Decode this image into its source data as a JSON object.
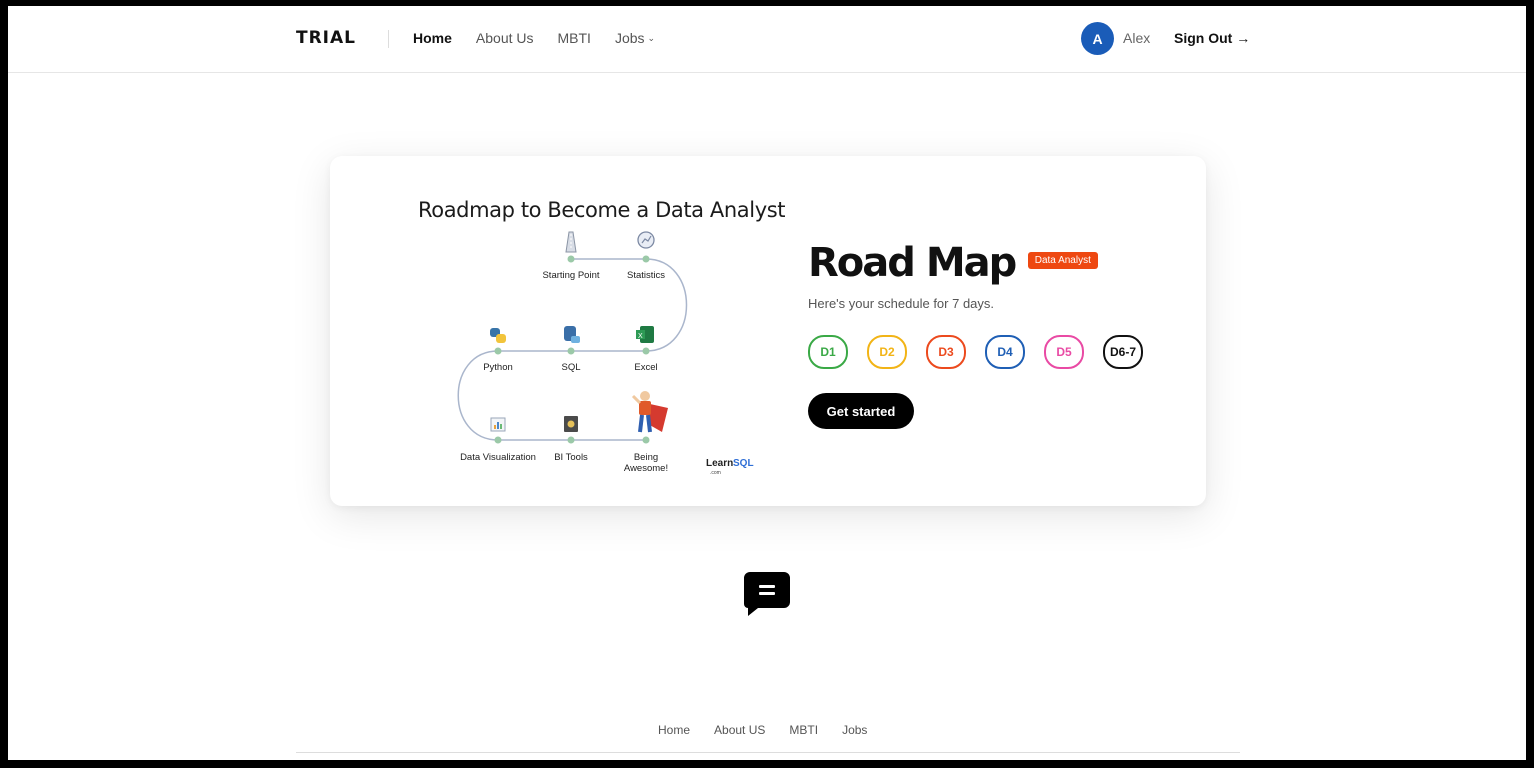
{
  "header": {
    "logo": "TRIAL",
    "nav": [
      {
        "label": "Home",
        "active": true
      },
      {
        "label": "About Us",
        "active": false
      },
      {
        "label": "MBTI",
        "active": false
      },
      {
        "label": "Jobs",
        "active": false
      }
    ],
    "user": {
      "initial": "A",
      "name": "Alex"
    },
    "signout": "Sign Out →"
  },
  "card": {
    "image": {
      "title": "Roadmap to Become a Data Analyst",
      "nodes": [
        "Starting Point",
        "Statistics",
        "Python",
        "SQL",
        "Excel",
        "Data Visualization",
        "BI Tools",
        "Being",
        "Awesome!"
      ],
      "brand_a": "Learn",
      "brand_b": "SQL",
      "brand_c": ".com"
    },
    "heading": "Road Map",
    "badge": "Data Analyst",
    "subtitle": "Here's your schedule for 7 days.",
    "days": [
      {
        "label": "D1",
        "color": "#3aa946"
      },
      {
        "label": "D2",
        "color": "#f2b416"
      },
      {
        "label": "D3",
        "color": "#ec4a1e"
      },
      {
        "label": "D4",
        "color": "#1f5fb5"
      },
      {
        "label": "D5",
        "color": "#e94aa4"
      },
      {
        "label": "D6-7",
        "color": "#111111"
      }
    ],
    "cta": "Get started"
  },
  "chat": {
    "icon": "chat-bubble-icon"
  },
  "footer": {
    "nav": [
      "Home",
      "About US",
      "MBTI",
      "Jobs"
    ]
  }
}
